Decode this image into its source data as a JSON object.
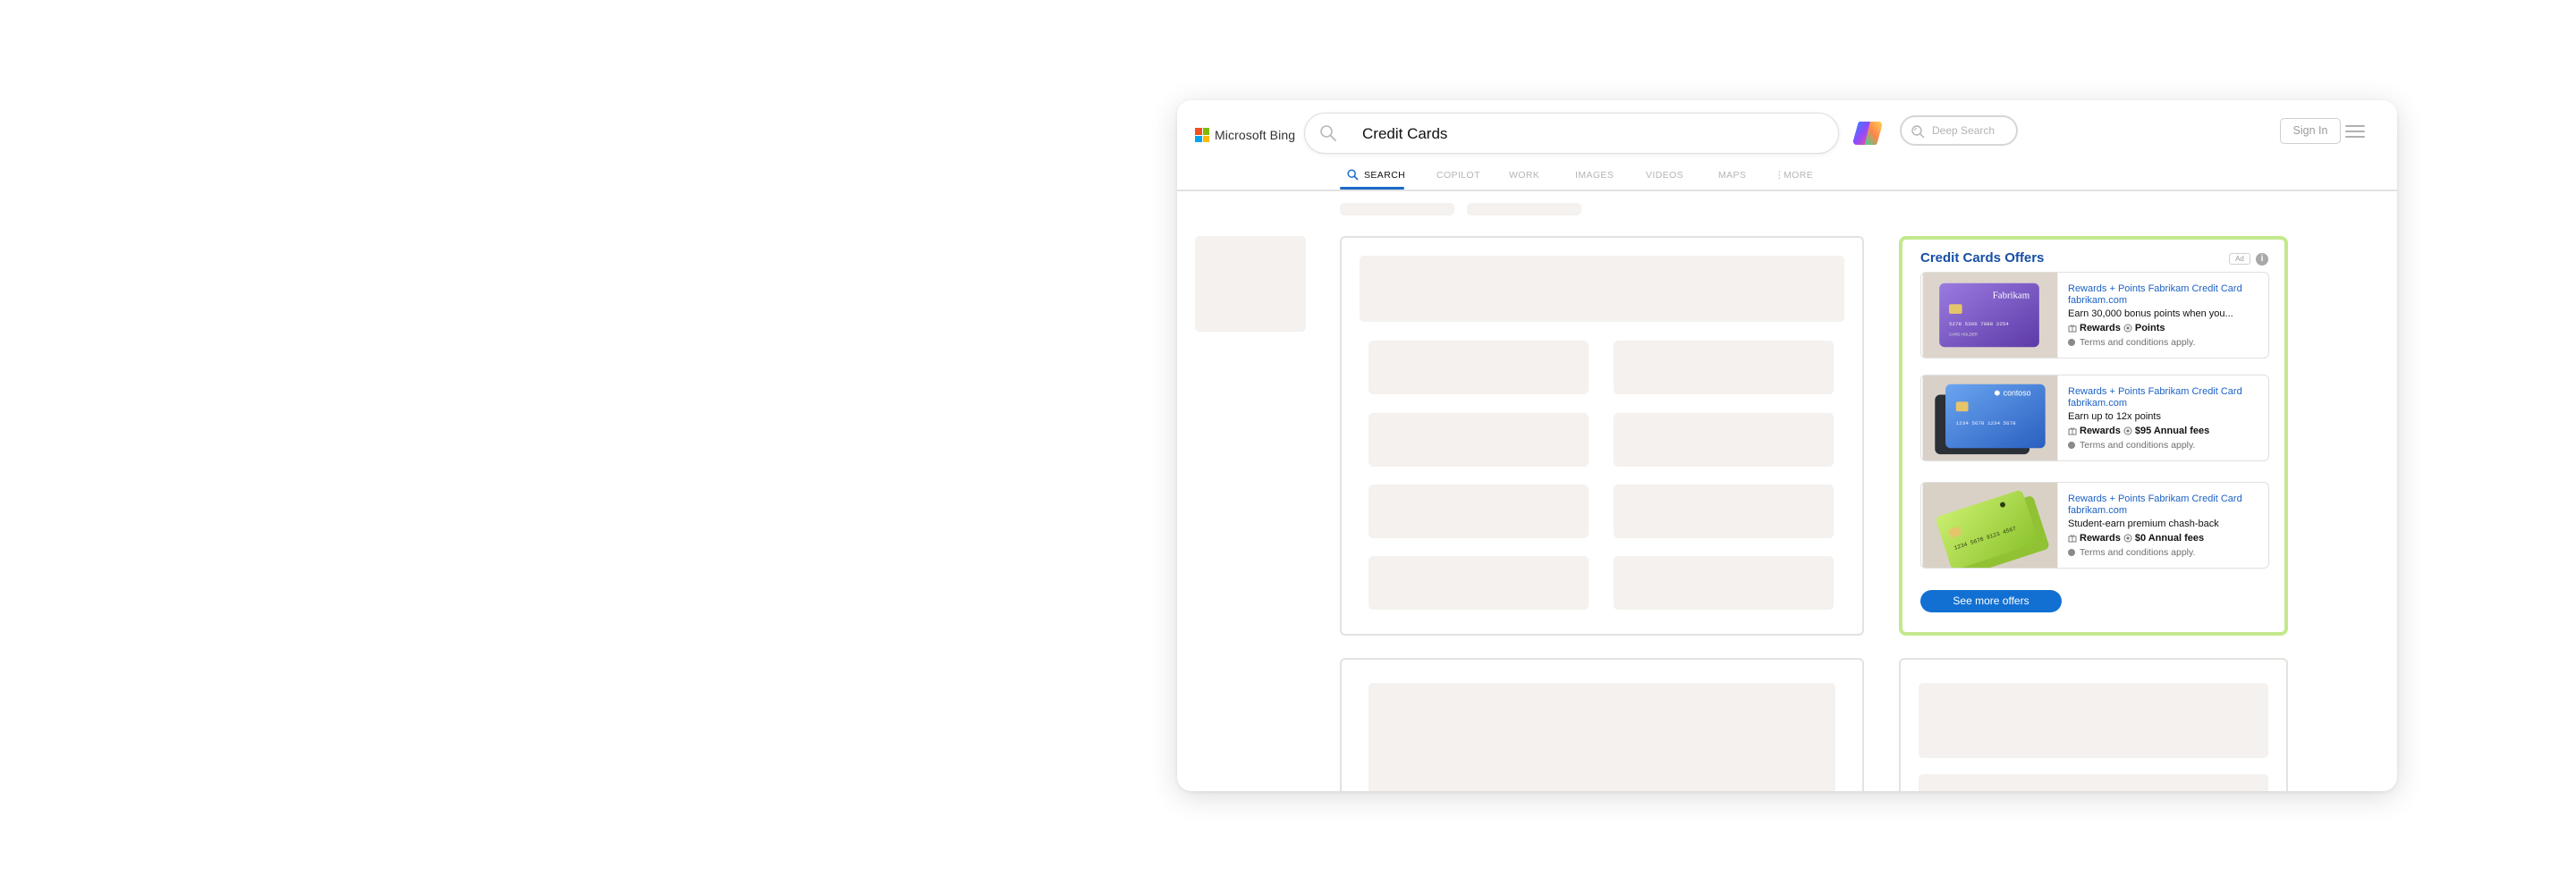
{
  "header": {
    "logo_text": "Microsoft Bing",
    "search_query": "Credit Cards",
    "deep_search_label": "Deep Search",
    "sign_in_label": "Sign In"
  },
  "tabs": [
    {
      "label": "SEARCH",
      "active": true
    },
    {
      "label": "COPILOT"
    },
    {
      "label": "WORK"
    },
    {
      "label": "IMAGES"
    },
    {
      "label": "VIDEOS"
    },
    {
      "label": "MAPS"
    },
    {
      "label": "MORE"
    }
  ],
  "ad": {
    "title": "Credit Cards Offers",
    "badge": "Ad",
    "info": "i",
    "offers": [
      {
        "name": "Rewards + Points Fabrikam Credit Card",
        "domain": "fabrikam.com",
        "desc": "Earn 30,000 bonus points when you...",
        "feature1": "Rewards",
        "feature2": "Points",
        "terms": "Terms and conditions apply.",
        "card_brand": "Fabrikam",
        "card_color": "#7e58c8"
      },
      {
        "name": "Rewards + Points Fabrikam Credit Card",
        "domain": "fabrikam.com",
        "desc": "Earn up to 12x points",
        "feature1": "Rewards",
        "feature2": "$95 Annual fees",
        "terms": "Terms and conditions apply.",
        "card_brand": "contoso",
        "card_color": "#3d77d6"
      },
      {
        "name": "Rewards + Points Fabrikam Credit Card",
        "domain": "fabrikam.com",
        "desc": "Student-earn premium chash-back",
        "feature1": "Rewards",
        "feature2": "$0 Annual fees",
        "terms": "Terms and conditions apply.",
        "card_brand": "",
        "card_color": "#a9d63f"
      }
    ],
    "more_button": "See more offers"
  },
  "colors": {
    "accent": "#1270d3",
    "ad_border": "#c3e88c",
    "ad_title": "#164fa6",
    "link": "#1c62c4",
    "skeleton": "#f4f1ee"
  }
}
